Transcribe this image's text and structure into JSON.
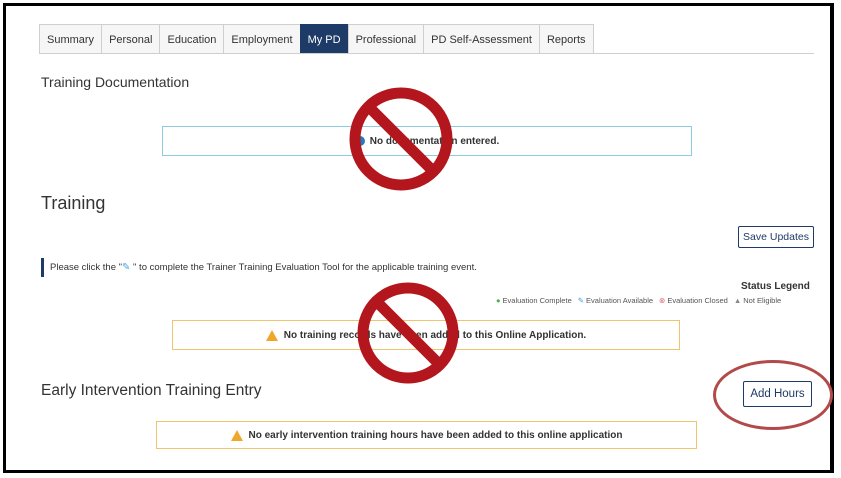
{
  "tabs": [
    {
      "label": "Summary",
      "active": false
    },
    {
      "label": "Personal",
      "active": false
    },
    {
      "label": "Education",
      "active": false
    },
    {
      "label": "Employment",
      "active": false
    },
    {
      "label": "My PD",
      "active": true
    },
    {
      "label": "Professional",
      "active": false
    },
    {
      "label": "PD Self-Assessment",
      "active": false
    },
    {
      "label": "Reports",
      "active": false
    }
  ],
  "training_documentation": {
    "heading": "Training Documentation",
    "message": "No documentation entered."
  },
  "training": {
    "heading": "Training",
    "save_label": "Save Updates",
    "note_before": "Please click the \"",
    "note_after": " \" to complete the Trainer Training Evaluation Tool for the applicable training event.",
    "legend_title": "Status Legend",
    "legend": [
      {
        "icon": "check-circle-icon",
        "symbol": "●",
        "label": "Evaluation Complete",
        "color": "#4caf50"
      },
      {
        "icon": "pencil-icon",
        "symbol": "✎",
        "label": "Evaluation Available",
        "color": "#4aa3df"
      },
      {
        "icon": "closed-circle-icon",
        "symbol": "⊗",
        "label": "Evaluation Closed",
        "color": "#e06070"
      },
      {
        "icon": "warning-icon",
        "symbol": "▲",
        "label": "Not Eligible",
        "color": "#888888"
      }
    ],
    "message": "No training records have been added to this Online Application."
  },
  "early_intervention": {
    "heading": "Early Intervention Training Entry",
    "add_label": "Add Hours",
    "message": "No early intervention training hours have been added to this online application"
  },
  "annotation_color": "#b3161c"
}
